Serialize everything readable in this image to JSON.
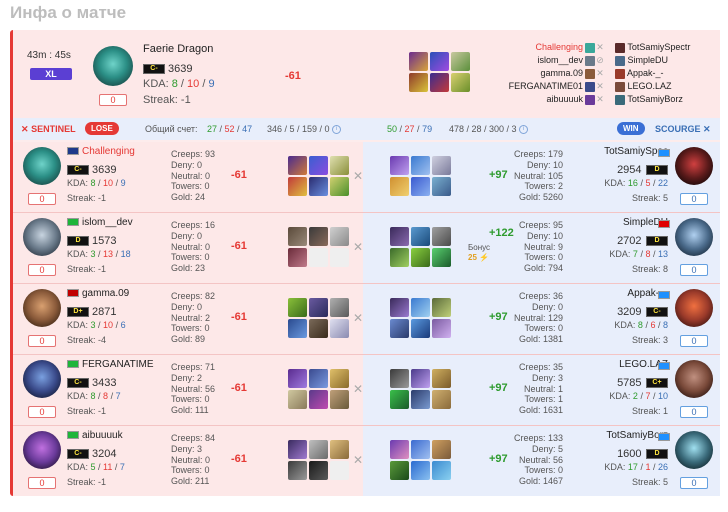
{
  "page_title": "Инфа о матче",
  "match": {
    "duration": "43m : 45s",
    "badge": "XL",
    "hero": "Faerie Dragon",
    "rank": "C-",
    "mmr": "3639",
    "kda": {
      "label": "KDA:",
      "k": "8",
      "d": "10",
      "a": "9"
    },
    "streak": "Streak: -1",
    "count": "0",
    "delta": "-61",
    "players_left": [
      "Challenging",
      "islom__dev",
      "gamma.09",
      "FERGANATIME01",
      "aibuuuuk"
    ],
    "players_right": [
      "TotSamiySpectr",
      "SimpleDU",
      "Appak-_-",
      "LEGO.LAZ",
      "TotSamiyBorz"
    ]
  },
  "teambar": {
    "sentinel": "SENTINEL",
    "lose": "LOSE",
    "total_label": "Общий счет:",
    "left_score": {
      "k": "27",
      "d": "52",
      "a": "47"
    },
    "left_extra": "346 / 5 / 159 / 0",
    "right_score": {
      "k": "50",
      "d": "27",
      "a": "79"
    },
    "right_extra": "478 / 28 / 300 / 3",
    "win": "WIN",
    "scourge": "SCOURGE"
  },
  "rows": [
    {
      "left": {
        "name": "Challenging",
        "rank": "C-",
        "mmr": "3639",
        "k": "8",
        "d": "10",
        "a": "9",
        "streak": "Streak: -1",
        "count": "0",
        "stats": [
          "Creeps: 93",
          "Deny: 0",
          "Neutral: 0",
          "Towers: 0",
          "Gold: 24"
        ],
        "delta": "-61"
      },
      "right": {
        "name": "TotSamiySpec",
        "rank": "D",
        "mmr": "2954",
        "k": "16",
        "d": "5",
        "a": "22",
        "streak": "Streak: 5",
        "count": "0",
        "stats": [
          "Creeps: 179",
          "Deny: 10",
          "Neutral: 105",
          "Towers: 2",
          "Gold: 5260"
        ],
        "delta": "+97"
      }
    },
    {
      "left": {
        "name": "islom__dev",
        "rank": "D",
        "mmr": "1573",
        "k": "3",
        "d": "13",
        "a": "18",
        "streak": "Streak: -1",
        "count": "0",
        "stats": [
          "Creeps: 16",
          "Deny: 0",
          "Neutral: 0",
          "Towers: 0",
          "Gold: 23"
        ],
        "delta": "-61"
      },
      "right": {
        "name": "SimpleDU",
        "rank": "D",
        "mmr": "2702",
        "k": "7",
        "d": "8",
        "a": "13",
        "streak": "Streak: 8",
        "count": "0",
        "stats": [
          "Creeps: 95",
          "Deny: 10",
          "Neutral: 9",
          "Towers: 0",
          "Gold: 794"
        ],
        "delta": "+122",
        "bonus_label": "Бонус",
        "bonus": "25"
      }
    },
    {
      "left": {
        "name": "gamma.09",
        "rank": "D+",
        "mmr": "2871",
        "k": "3",
        "d": "10",
        "a": "6",
        "streak": "Streak: -4",
        "count": "0",
        "stats": [
          "Creeps: 82",
          "Deny: 0",
          "Neutral: 2",
          "Towers: 0",
          "Gold: 89"
        ],
        "delta": "-61"
      },
      "right": {
        "name": "Appak-_-",
        "rank": "C-",
        "mmr": "3209",
        "k": "8",
        "d": "6",
        "a": "8",
        "streak": "Streak: 3",
        "count": "0",
        "stats": [
          "Creeps: 36",
          "Deny: 0",
          "Neutral: 129",
          "Towers: 0",
          "Gold: 1381"
        ],
        "delta": "+97"
      }
    },
    {
      "left": {
        "name": "FERGANATIME",
        "rank": "C-",
        "mmr": "3433",
        "k": "8",
        "d": "8",
        "a": "7",
        "streak": "Streak: -1",
        "count": "0",
        "stats": [
          "Creeps: 71",
          "Deny: 2",
          "Neutral: 56",
          "Towers: 0",
          "Gold: 111"
        ],
        "delta": "-61"
      },
      "right": {
        "name": "LEGO.LAZ",
        "rank": "C+",
        "mmr": "5785",
        "k": "2",
        "d": "7",
        "a": "10",
        "streak": "Streak: 1",
        "count": "0",
        "stats": [
          "Creeps: 35",
          "Deny: 3",
          "Neutral: 1",
          "Towers: 1",
          "Gold: 1631"
        ],
        "delta": "+97"
      }
    },
    {
      "left": {
        "name": "aibuuuuk",
        "rank": "C-",
        "mmr": "3204",
        "k": "5",
        "d": "11",
        "a": "7",
        "streak": "Streak: -1",
        "count": "0",
        "stats": [
          "Creeps: 84",
          "Deny: 3",
          "Neutral: 0",
          "Towers: 0",
          "Gold: 211"
        ],
        "delta": "-61"
      },
      "right": {
        "name": "TotSamiyBorz",
        "rank": "D",
        "mmr": "1600",
        "k": "17",
        "d": "1",
        "a": "26",
        "streak": "Streak: 5",
        "count": "0",
        "stats": [
          "Creeps: 133",
          "Deny: 5",
          "Neutral: 56",
          "Towers: 0",
          "Gold: 1467"
        ],
        "delta": "+97"
      }
    }
  ]
}
